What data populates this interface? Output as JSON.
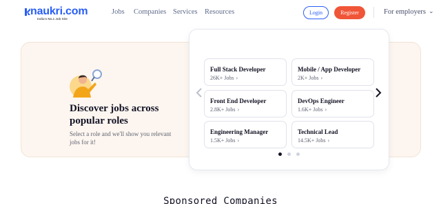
{
  "brand": {
    "logo_text": "naukri.com",
    "tagline": "India's No.1 Job Site",
    "color": "#275df5"
  },
  "nav": {
    "items": [
      "Jobs",
      "Companies",
      "Services",
      "Resources"
    ]
  },
  "auth": {
    "login_label": "Login",
    "register_label": "Register",
    "register_color": "#f05537"
  },
  "employers": {
    "label": "For employers",
    "icon": "chevron-down-icon"
  },
  "hero": {
    "headline": "Discover jobs across popular roles",
    "subtext": "Select a role and we'll show you relevant jobs for it!",
    "illustration": "person-with-magnifier"
  },
  "roles": [
    {
      "title": "Full Stack Developer",
      "count": "26K+ Jobs"
    },
    {
      "title": "Mobile / App Developer",
      "count": "2K+ Jobs"
    },
    {
      "title": "Front End Developer",
      "count": "2.8K+ Jobs"
    },
    {
      "title": "DevOps Engineer",
      "count": "1.6K+ Jobs"
    },
    {
      "title": "Engineering Manager",
      "count": "1.5K+ Jobs"
    },
    {
      "title": "Technical Lead",
      "count": "14.5K+ Jobs"
    }
  ],
  "carousel": {
    "pages": 3,
    "active_page": 1,
    "prev_icon": "chevron-left-icon",
    "next_icon": "chevron-right-icon"
  },
  "sections": {
    "sponsored_title": "Sponsored Companies"
  }
}
